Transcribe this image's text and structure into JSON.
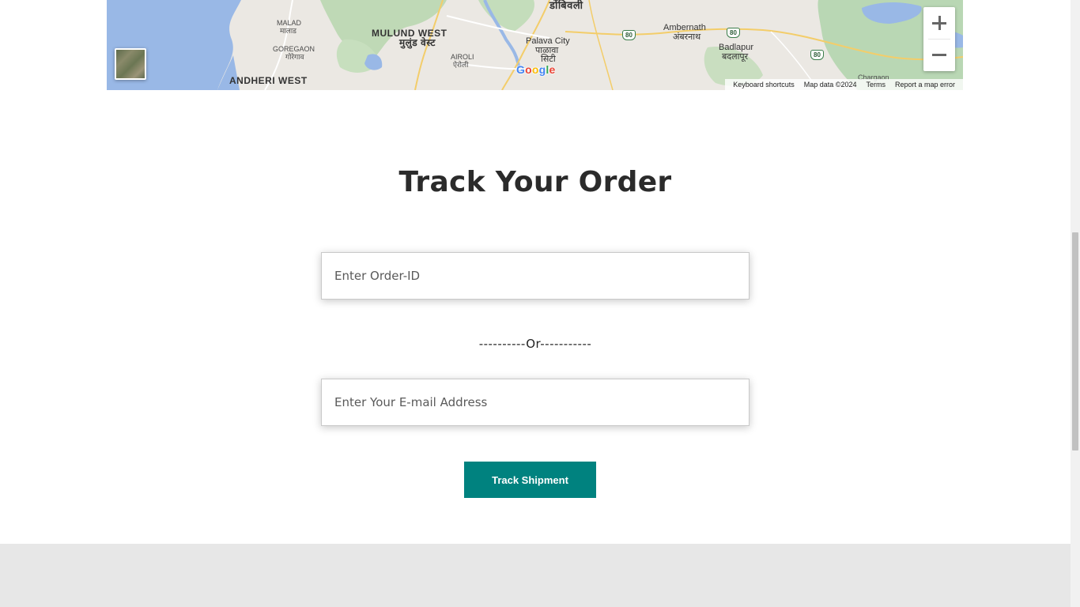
{
  "map": {
    "place_labels": {
      "dombivli": "डोंबिवली",
      "malad_en": "MALAD",
      "malad_local": "मालाड",
      "goregaon_en": "GOREGAON",
      "goregaon_local": "गोरेगाव",
      "mulund_en": "MULUND WEST",
      "mulund_local": "मुलुंड वेस्ट",
      "airoli_en": "AIROLI",
      "airoli_local": "ऐरोली",
      "palava_en": "Palava City",
      "palava_local1": "पाळावा",
      "palava_local2": "सिटी",
      "ambernath_en": "Ambernath",
      "ambernath_local": "अंबरनाथ",
      "badlapur_en": "Badlapur",
      "badlapur_local": "बदलापूर",
      "andheri_en": "ANDHERI WEST",
      "chargaon": "Chargaon"
    },
    "highway_shields": [
      "80",
      "80",
      "80"
    ],
    "google_logo": {
      "letters": [
        "G",
        "o",
        "o",
        "g",
        "l",
        "e"
      ],
      "colors": [
        "#4285F4",
        "#EA4335",
        "#FBBC05",
        "#4285F4",
        "#34A853",
        "#EA4335"
      ]
    },
    "attribution": {
      "keyboard_shortcuts": "Keyboard shortcuts",
      "map_data": "Map data ©2024",
      "terms": "Terms",
      "report_error": "Report a map error"
    },
    "zoom_in_icon": "plus-icon",
    "zoom_out_icon": "minus-icon",
    "layer_toggle": "satellite-thumbnail"
  },
  "track": {
    "title": "Track Your Order",
    "order_id_placeholder": "Enter Order-ID",
    "separator": "----------Or-----------",
    "email_placeholder": "Enter Your E-mail Address",
    "button_label": "Track Shipment"
  },
  "colors": {
    "button": "#00827f",
    "footer_band": "#e7e7e7",
    "water": "#99b8e6"
  }
}
